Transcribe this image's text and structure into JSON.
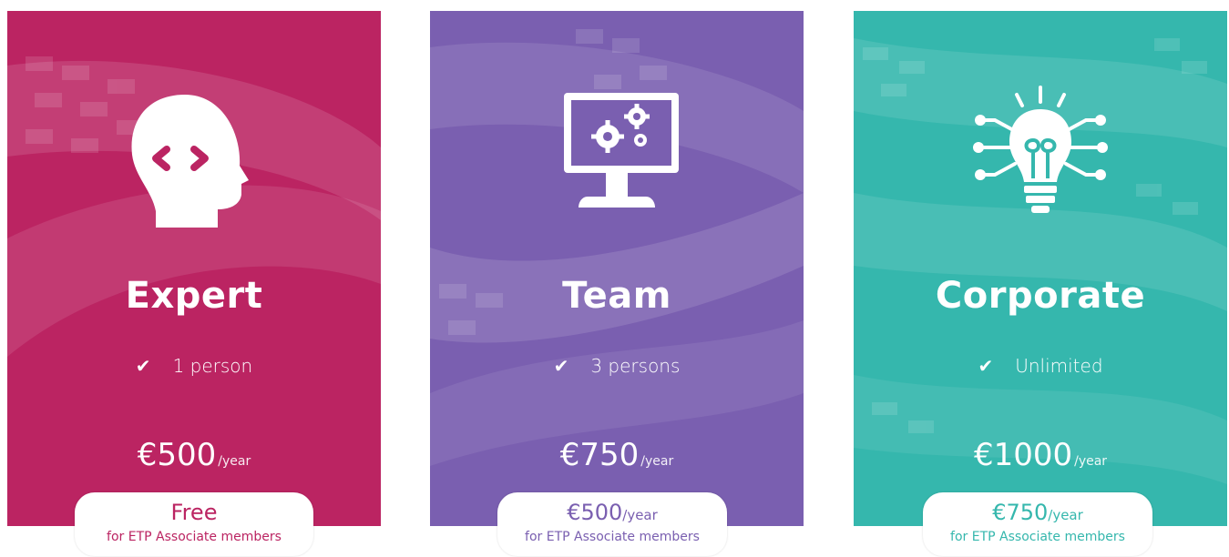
{
  "plans": [
    {
      "id": "expert",
      "name": "Expert",
      "feature": "1 person",
      "price": "€500",
      "period": "/year",
      "member_price": "Free",
      "member_period": "",
      "member_note": "for ETP Associate members",
      "icon": "head-code-icon",
      "color": "#bb2462"
    },
    {
      "id": "team",
      "name": "Team",
      "feature": "3 persons",
      "price": "€750",
      "period": "/year",
      "member_price": "€500",
      "member_period": "/year",
      "member_note": "for ETP Associate members",
      "icon": "monitor-gears-icon",
      "color": "#7a5fb0"
    },
    {
      "id": "corporate",
      "name": "Corporate",
      "feature": "Unlimited",
      "price": "€1000",
      "period": "/year",
      "member_price": "€750",
      "member_period": "/year",
      "member_note": "for ETP Associate members",
      "icon": "lightbulb-circuit-icon",
      "color": "#35b7ad"
    }
  ],
  "check_glyph": "✔"
}
